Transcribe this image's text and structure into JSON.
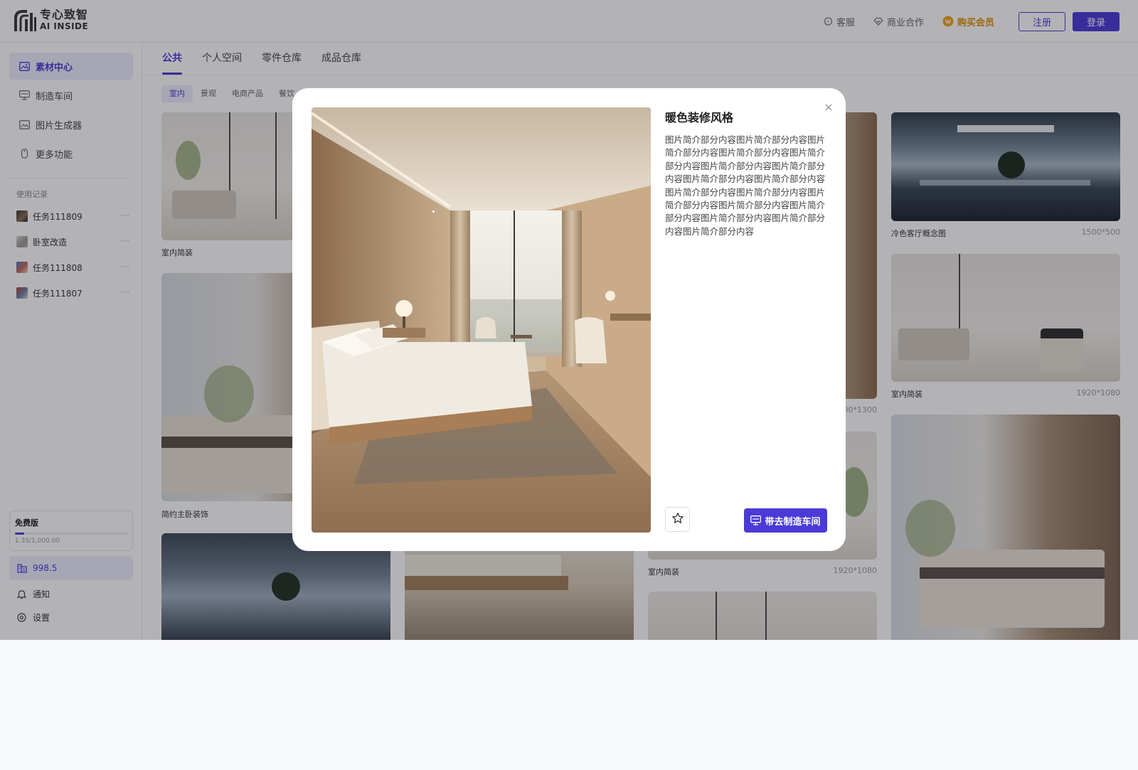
{
  "colors": {
    "accent": "#4a3ad8",
    "vip": "#e0900a",
    "accent_soft": "#eeecfc"
  },
  "brand": {
    "name": "专心致智",
    "tagline": "AI INSIDE"
  },
  "header": {
    "links": [
      {
        "label": "客服",
        "icon": "chat-bubble-icon"
      },
      {
        "label": "商业合作",
        "icon": "handshake-diamond-icon"
      },
      {
        "label": "购买会员",
        "icon": "vip-coin-icon"
      }
    ],
    "register_label": "注册",
    "login_label": "登录"
  },
  "sidebar": {
    "nav": [
      {
        "label": "素材中心",
        "icon": "gallery-icon",
        "active": true
      },
      {
        "label": "制造车间",
        "icon": "workshop-icon"
      },
      {
        "label": "图片生成器",
        "icon": "image-generator-icon"
      },
      {
        "label": "更多功能",
        "icon": "mouse-icon"
      }
    ],
    "history_title": "使用记录",
    "history": [
      {
        "label": "任务111809"
      },
      {
        "label": "卧室改造"
      },
      {
        "label": "任务111808"
      },
      {
        "label": "任务111807"
      }
    ],
    "more_glyph": "···",
    "plan": {
      "title": "免费版",
      "usage": "1.35/1,000.00",
      "progress": 0.08
    },
    "balance": "998.5",
    "notify_label": "通知",
    "settings_label": "设置"
  },
  "tabs": [
    {
      "label": "公共",
      "active": true
    },
    {
      "label": "个人空间"
    },
    {
      "label": "零件仓库"
    },
    {
      "label": "成品仓库"
    }
  ],
  "chips": [
    {
      "label": "室内",
      "active": true
    },
    {
      "label": "景观"
    },
    {
      "label": "电商产品"
    },
    {
      "label": "餐饮"
    }
  ],
  "gallery": {
    "c1a": {
      "caption": "室内简装"
    },
    "c1b": {
      "caption": "简约主卧装饰"
    },
    "c3a": {
      "dims": "00*1300"
    },
    "c3b": {
      "caption": "室内简装",
      "dims": "1920*1080"
    },
    "c4a": {
      "caption": "冷色客厅概念图",
      "dims": "1500*500"
    },
    "c4b": {
      "caption": "室内简装",
      "dims": "1920*1080"
    }
  },
  "modal": {
    "title": "暖色装修风格",
    "description": "图片简介部分内容图片简介部分内容图片简介部分内容图片简介部分内容图片简介部分内容图片简介部分内容图片简介部分内容图片简介部分内容图片简介部分内容图片简介部分内容图片简介部分内容图片简介部分内容图片简介部分内容图片简介部分内容图片简介部分内容图片简介部分内容图片简介部分内容",
    "go_label": "带去制造车间"
  }
}
